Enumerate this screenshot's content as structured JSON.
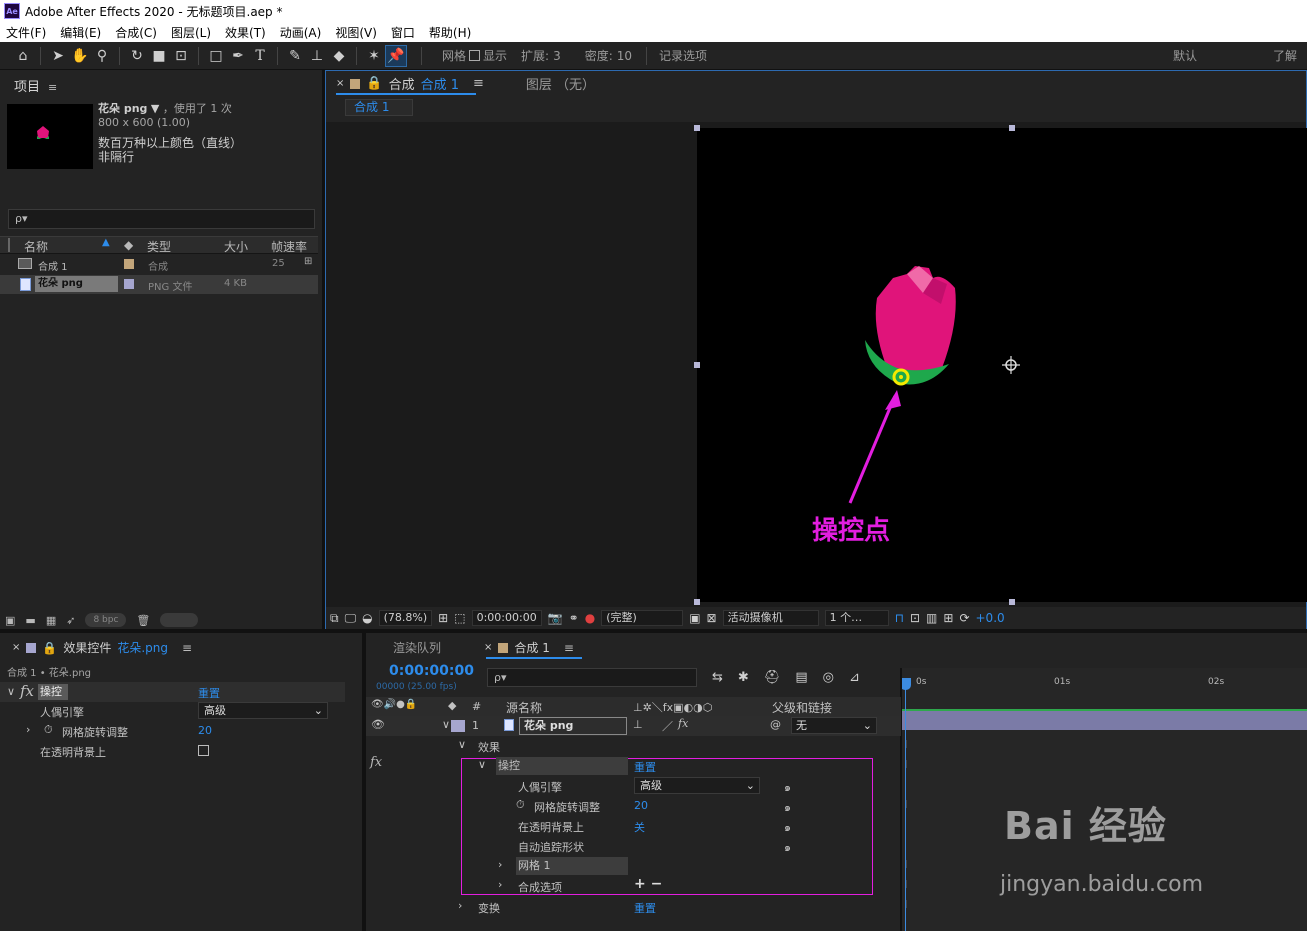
{
  "app": {
    "logo": "Ae",
    "title": "Adobe After Effects 2020 - 无标题项目.aep *"
  },
  "menu": [
    "文件(F)",
    "编辑(E)",
    "合成(C)",
    "图层(L)",
    "效果(T)",
    "动画(A)",
    "视图(V)",
    "窗口",
    "帮助(H)"
  ],
  "toolbar": {
    "grid_label": "网格",
    "show_label": "显示",
    "expand_label": "扩展:",
    "expand_value": "3",
    "density_label": "密度:",
    "density_value": "10",
    "record_options": "记录选项",
    "workspace_default": "默认",
    "workspace_learn": "了解"
  },
  "project": {
    "tab": "项目",
    "asset_name": "花朵 png",
    "asset_usage": "，使用了 1 次",
    "asset_size": "800 x 600 (1.00)",
    "asset_color": "数百万种以上颜色（直线）",
    "asset_interlace": "非隔行",
    "search_placeholder": "ρ▾",
    "columns": {
      "name": "名称",
      "type": "类型",
      "size": "大小",
      "fps": "帧速率"
    },
    "items": [
      {
        "name": "合成 1",
        "type": "合成",
        "size": "",
        "fps": "25",
        "swatch": "#c2a57a"
      },
      {
        "name": "花朵 png",
        "type": "PNG 文件",
        "size": "4 KB",
        "fps": "",
        "swatch": "#a6a6cf"
      }
    ],
    "bpc": "8 bpc"
  },
  "composition": {
    "tab_prefix": "合成",
    "tab_name": "合成 1",
    "layer_tab": "图层 （无）",
    "breadcrumb": "合成 1",
    "annotation": "操控点",
    "footer": {
      "zoom": "(78.8%)",
      "time": "0:00:00:00",
      "resolution": "(完整)",
      "camera": "活动摄像机",
      "views": "1 个…",
      "exposure": "+0.0"
    }
  },
  "effects": {
    "tab": "效果控件",
    "tab_layer": "花朵.png",
    "breadcrumb": "合成 1 • 花朵.png",
    "fx_label": "fx",
    "effect_name": "操控",
    "reset": "重置",
    "rows": [
      {
        "label": "人偶引擎",
        "value": "高级"
      },
      {
        "label": "网格旋转调整",
        "value": "20"
      },
      {
        "label": "在透明背景上",
        "value": ""
      }
    ]
  },
  "timeline": {
    "render_tab": "渲染队列",
    "comp_tab": "合成 1",
    "timecode": "0:00:00:00",
    "frame_info": "00000 (25.00 fps)",
    "search_placeholder": "ρ▾",
    "col_num": "#",
    "col_source": "源名称",
    "col_parent": "父级和链接",
    "ruler": [
      "0s",
      "01s",
      "02s"
    ],
    "layer": {
      "index": "1",
      "name": "花朵 png",
      "parent": "无"
    },
    "props": {
      "effects_group": "效果",
      "fx_label": "fx",
      "effect_name": "操控",
      "reset": "重置",
      "puppet_engine": "人偶引擎",
      "puppet_engine_value": "高级",
      "mesh_rotation": "网格旋转调整",
      "mesh_rotation_value": "20",
      "on_transparent": "在透明背景上",
      "on_transparent_value": "关",
      "auto_trace": "自动追踪形状",
      "mesh": "网格 1",
      "composite": "合成选项",
      "composite_ctrl": "+ −",
      "transform": "变换",
      "transform_reset": "重置"
    }
  },
  "watermark": {
    "brand": "Bai 经验",
    "url": "jingyan.baidu.com"
  },
  "colors": {
    "accent": "#2d8ceb",
    "annotation": "#e31ee0",
    "flower": "#e0147a",
    "leaf": "#1ea84c"
  }
}
